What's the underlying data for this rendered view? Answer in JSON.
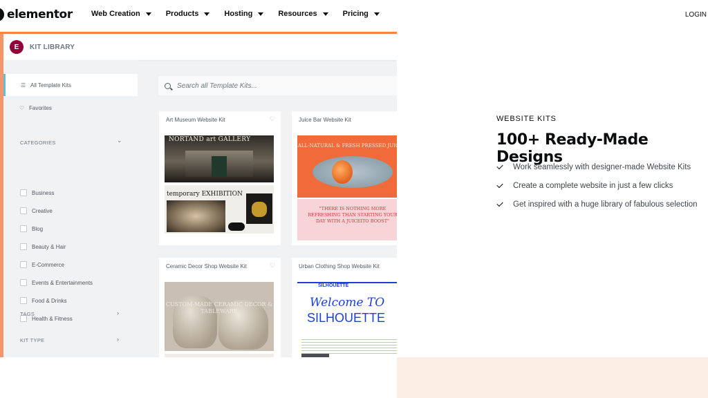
{
  "nav": {
    "logo": "elementor",
    "items": [
      "Web Creation",
      "Products",
      "Hosting",
      "Resources",
      "Pricing"
    ],
    "login": "LOGIN"
  },
  "kit_library": {
    "logo_glyph": "E",
    "title": "KIT LIBRARY",
    "sidebar": {
      "all": "All Template Kits",
      "favorites": "Favorites",
      "categories_label": "CATEGORIES",
      "categories": [
        "Business",
        "Creative",
        "Blog",
        "Beauty & Hair",
        "E-Commerce",
        "Events & Entertainments",
        "Food & Drinks",
        "Health & Fitness"
      ],
      "tags_label": "TAGS",
      "kit_type_label": "KIT TYPE"
    },
    "search_placeholder": "Search all Template Kits...",
    "cards": [
      {
        "title": "Art Museum Website Kit",
        "thumb_text_1": "NORTAND art GALLERY",
        "thumb_text_2": "temporary EXHIBITION"
      },
      {
        "title": "Juice Bar Website Kit",
        "thumb_text_1": "ALL-NATURAL & FRESH PRESSED JUICES",
        "thumb_text_2": "\"THERE IS NOTHING MORE REFRESHING THAN STARTING YOUR DAY WITH A JUICEITO BOOST\""
      },
      {
        "title": "Ceramic Decor Shop Website Kit",
        "thumb_text_1": "CUSTOM-MADE CERAMIC DECOR & TABLEWARE"
      },
      {
        "title": "Urban Clothing Shop Website Kit",
        "thumb_text_1": "SILHOUETTE",
        "thumb_text_2": "Welcome TO",
        "thumb_text_3": "SILHOUETTE"
      }
    ]
  },
  "hero": {
    "eyebrow": "WEBSITE KITS",
    "title": "100+ Ready-Made Designs",
    "bullets": [
      "Work seamlessly with designer-made Website Kits",
      "Create a complete website in just a few clicks",
      "Get inspired with a huge library of fabulous selection"
    ]
  },
  "colors": {
    "accent_orange": "#f0834a",
    "elementor_maroon": "#93003c",
    "peach_bg": "#fdeee5"
  }
}
